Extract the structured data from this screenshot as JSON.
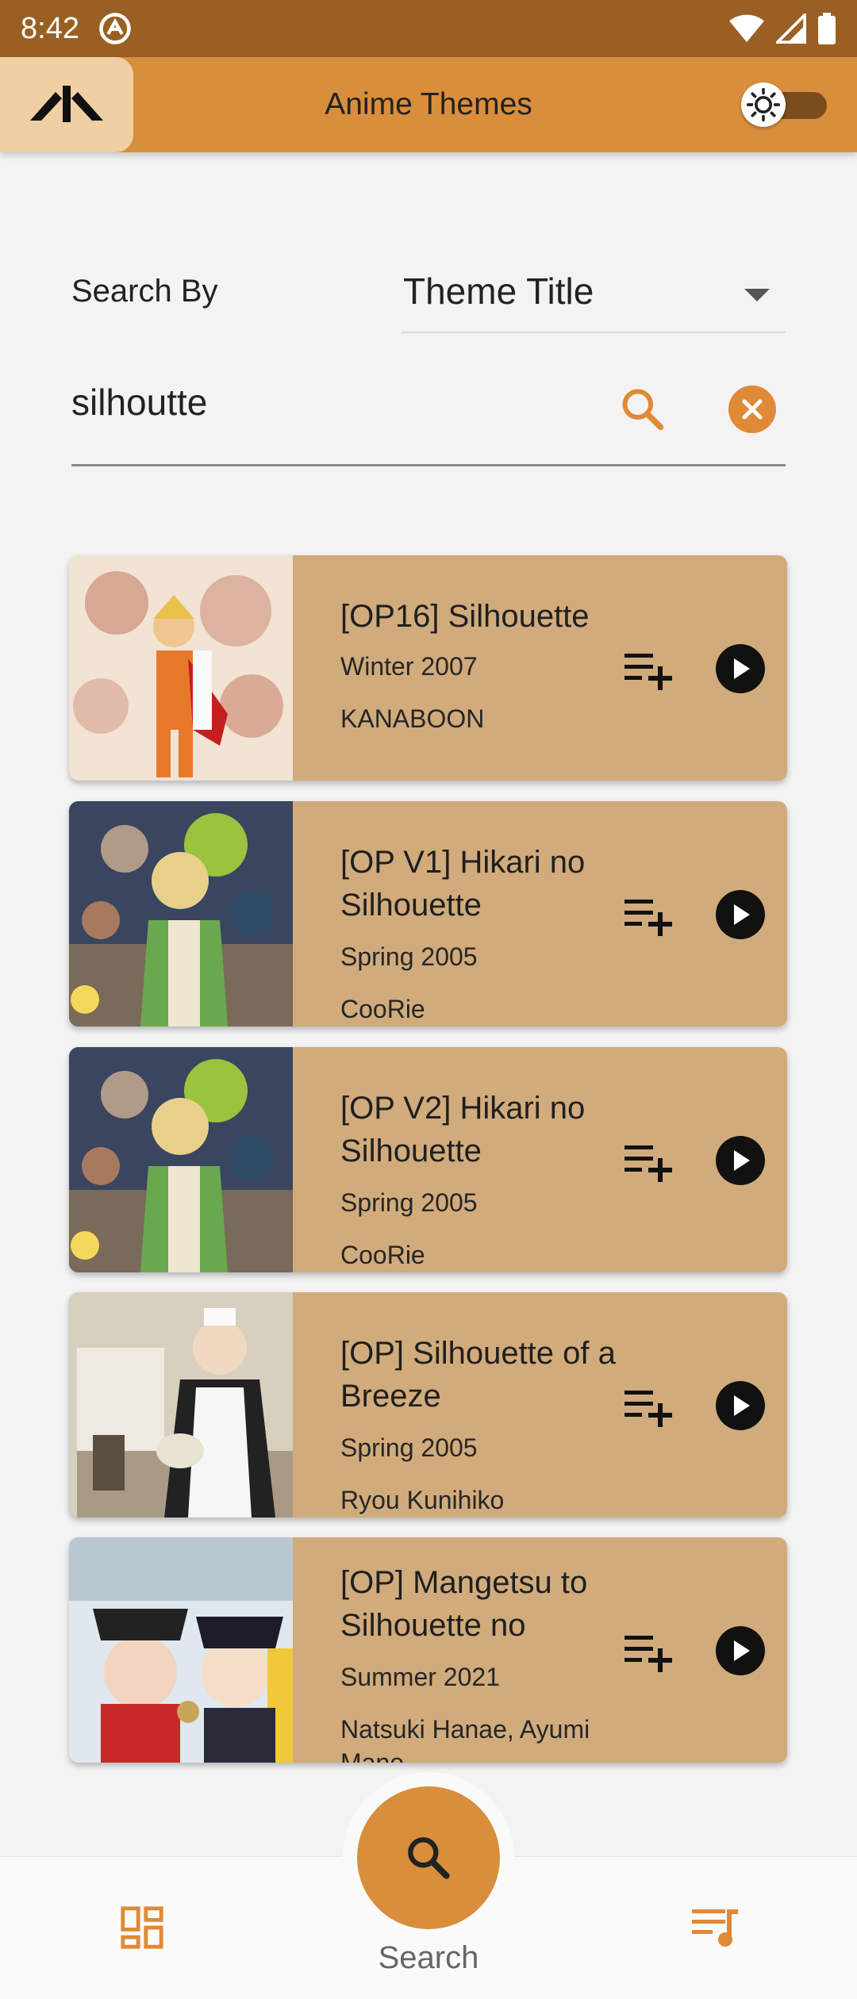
{
  "status_bar": {
    "time": "8:42"
  },
  "app_bar": {
    "title": "Anime Themes"
  },
  "search": {
    "by_label": "Search By",
    "by_value": "Theme Title",
    "query": "silhoutte"
  },
  "results": [
    {
      "title": "[OP16] Silhouette",
      "season": "Winter 2007",
      "artist": "KANABOON"
    },
    {
      "title": "[OP V1] Hikari no Silhouette",
      "season": "Spring 2005",
      "artist": "CooRie"
    },
    {
      "title": "[OP V2] Hikari no Silhouette",
      "season": "Spring 2005",
      "artist": "CooRie"
    },
    {
      "title": "[OP] Silhouette of a Breeze",
      "season": "Spring 2005",
      "artist": "Ryou Kunihiko"
    },
    {
      "title": "[OP] Mangetsu to Silhouette no",
      "season": "Summer 2021",
      "artist": "Natsuki Hanae, Ayumi Mano"
    }
  ],
  "bottom_nav": {
    "center_label": "Search"
  },
  "colors": {
    "accent": "#d98e3b",
    "card": "#d1ab7c",
    "status_bar": "#9a6023"
  },
  "icons": [
    "brand-icon",
    "wifi-icon",
    "signal-icon",
    "battery-icon",
    "logo-icon",
    "sun-icon",
    "search-icon",
    "close-icon",
    "playlist-add-icon",
    "play-icon",
    "dashboard-icon",
    "queue-music-icon"
  ]
}
